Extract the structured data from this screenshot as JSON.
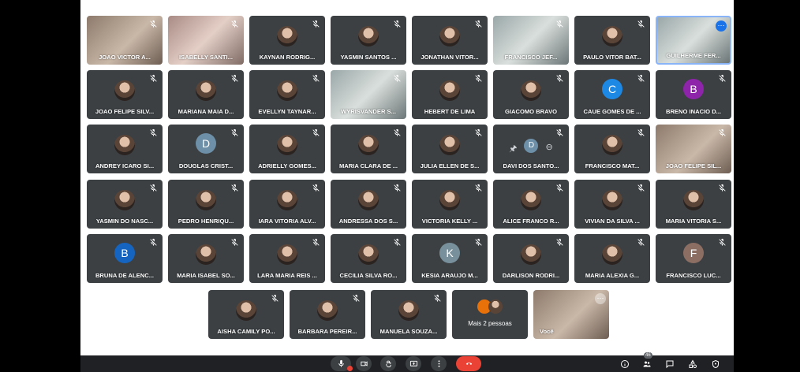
{
  "tiles": [
    {
      "name": "JOAO VICTOR A...",
      "kind": "video",
      "variant": "v1"
    },
    {
      "name": "ISABELLY SANTI...",
      "kind": "video",
      "variant": "v2"
    },
    {
      "name": "KAYNAN RODRIG...",
      "kind": "avatar"
    },
    {
      "name": "YASMIN SANTOS ...",
      "kind": "avatar"
    },
    {
      "name": "JONATHAN VITOR...",
      "kind": "avatar"
    },
    {
      "name": "FRANCISCO JEF...",
      "kind": "video",
      "variant": "v3"
    },
    {
      "name": "PAULO VITOR BAT...",
      "kind": "avatar"
    },
    {
      "name": "GUILHERME FER...",
      "kind": "video",
      "variant": "v3",
      "self_menu": true
    },
    {
      "name": "JOAO FELIPE SILV...",
      "kind": "avatar"
    },
    {
      "name": "MARIANA MAIA D...",
      "kind": "avatar"
    },
    {
      "name": "EVELLYN TAYNAR...",
      "kind": "avatar"
    },
    {
      "name": "WYRISVANDER S...",
      "kind": "video",
      "variant": "v3"
    },
    {
      "name": "HEBERT DE LIMA",
      "kind": "avatar"
    },
    {
      "name": "GIACOMO BRAVO",
      "kind": "avatar"
    },
    {
      "name": "CAUE GOMES DE ...",
      "kind": "letter",
      "letter": "C",
      "color": "#1e88e5"
    },
    {
      "name": "BRENO INACIO D...",
      "kind": "letter",
      "letter": "B",
      "color": "#8e24aa"
    },
    {
      "name": "ANDREY ICARO SI...",
      "kind": "avatar"
    },
    {
      "name": "DOUGLAS CRIST...",
      "kind": "letter",
      "letter": "D",
      "color": "#6d8fa8"
    },
    {
      "name": "ADRIELLY GOMES...",
      "kind": "avatar"
    },
    {
      "name": "MARIA CLARA DE ...",
      "kind": "avatar"
    },
    {
      "name": "JULIA ELLEN DE S...",
      "kind": "avatar"
    },
    {
      "name": "DAVI DOS SANTO...",
      "kind": "pinned",
      "letter": "D",
      "color": "#6d8fa8"
    },
    {
      "name": "FRANCISCO MAT...",
      "kind": "avatar"
    },
    {
      "name": "JOAO FELIPE SIL...",
      "kind": "video",
      "variant": "v1"
    },
    {
      "name": "YASMIN DO NASC...",
      "kind": "avatar"
    },
    {
      "name": "PEDRO HENRIQU...",
      "kind": "avatar"
    },
    {
      "name": "IARA VITORIA ALV...",
      "kind": "avatar"
    },
    {
      "name": "ANDRESSA DOS S...",
      "kind": "avatar"
    },
    {
      "name": "VICTORIA KELLY ...",
      "kind": "avatar"
    },
    {
      "name": "ALICE FRANCO R...",
      "kind": "avatar"
    },
    {
      "name": "VIVIAN DA SILVA ...",
      "kind": "avatar"
    },
    {
      "name": "MARIA VITORIA S...",
      "kind": "avatar"
    },
    {
      "name": "BRUNA DE ALENC...",
      "kind": "letter",
      "letter": "B",
      "color": "#1565c0"
    },
    {
      "name": "MARIA ISABEL SO...",
      "kind": "avatar"
    },
    {
      "name": "LARA MARIA REIS ...",
      "kind": "avatar"
    },
    {
      "name": "CECILIA SILVA RO...",
      "kind": "avatar"
    },
    {
      "name": "KESIA ARAUJO M...",
      "kind": "letter",
      "letter": "K",
      "color": "#78909c"
    },
    {
      "name": "DARLISON RODRI...",
      "kind": "avatar"
    },
    {
      "name": "MARIA ALEXIA G...",
      "kind": "avatar"
    },
    {
      "name": "FRANCISCO LUC...",
      "kind": "letter",
      "letter": "F",
      "color": "#8d6e63"
    },
    {
      "name": "AISHA CAMILY PO...",
      "kind": "avatar"
    },
    {
      "name": "BARBARA PEREIR...",
      "kind": "avatar"
    },
    {
      "name": "MANUELA SOUZA...",
      "kind": "avatar"
    },
    {
      "name": "Mais 2 pessoas",
      "kind": "extra"
    },
    {
      "name": "Você",
      "kind": "self"
    }
  ],
  "participants_count": "46",
  "colors": {
    "tile": "#3c4043",
    "bar": "#202124",
    "end_call": "#ea4335",
    "accent": "#1a73e8"
  },
  "icons": {
    "muted": "mic-off-icon",
    "pin": "pin-icon",
    "remove": "remove-circle-icon",
    "more": "more-options-icon",
    "controls": [
      "mic-icon",
      "camera-icon",
      "raise-hand-icon",
      "present-screen-icon",
      "more-vert-icon",
      "end-call-icon"
    ],
    "right_controls": [
      "info-icon",
      "people-icon",
      "chat-icon",
      "activities-icon",
      "security-icon"
    ]
  }
}
